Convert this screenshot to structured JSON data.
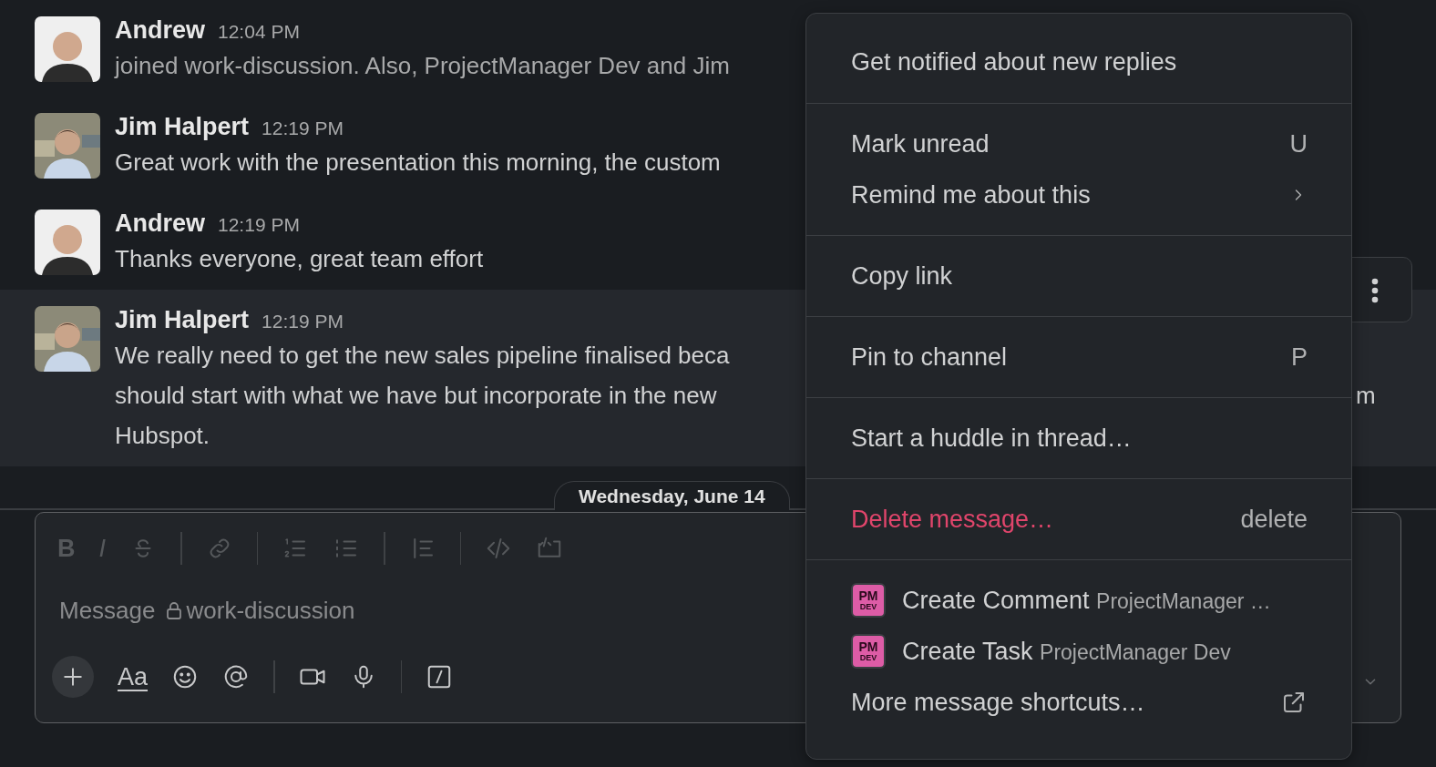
{
  "messages": [
    {
      "author": "Andrew",
      "time": "12:04 PM",
      "lines": [
        "joined work-discussion. Also, ProjectManager Dev and Jim"
      ],
      "muted": true,
      "highlighted": false
    },
    {
      "author": "Jim Halpert",
      "time": "12:19 PM",
      "lines": [
        "Great work with the presentation this morning, the custom"
      ],
      "muted": false,
      "highlighted": false
    },
    {
      "author": "Andrew",
      "time": "12:19 PM",
      "lines": [
        "Thanks everyone, great team effort"
      ],
      "muted": false,
      "highlighted": false
    },
    {
      "author": "Jim Halpert",
      "time": "12:19 PM",
      "lines": [
        "We really need to get the new sales pipeline finalised beca",
        "should start with what we have but incorporate in the new",
        "Hubspot."
      ],
      "muted": false,
      "highlighted": true,
      "trailing_fragment": "m"
    }
  ],
  "date_divider": "Wednesday, June 14",
  "composer": {
    "format_tools": [
      {
        "kind": "bold",
        "label": "B"
      },
      {
        "kind": "italic",
        "label": "I"
      },
      {
        "kind": "strike"
      },
      {
        "kind": "sep"
      },
      {
        "kind": "link"
      },
      {
        "kind": "sep"
      },
      {
        "kind": "ordered"
      },
      {
        "kind": "bullet"
      },
      {
        "kind": "sep"
      },
      {
        "kind": "quote"
      },
      {
        "kind": "sep"
      },
      {
        "kind": "code"
      },
      {
        "kind": "codeblock"
      }
    ],
    "placeholder": "Message",
    "channel": "work-discussion",
    "actions": [
      {
        "kind": "plus"
      },
      {
        "kind": "text",
        "label": "Aa"
      },
      {
        "kind": "emoji"
      },
      {
        "kind": "mention"
      },
      {
        "kind": "sep"
      },
      {
        "kind": "video"
      },
      {
        "kind": "mic"
      },
      {
        "kind": "sep"
      },
      {
        "kind": "slash"
      }
    ]
  },
  "menu": {
    "sections": [
      [
        {
          "kind": "plain",
          "label": "Get notified about new replies"
        }
      ],
      [
        {
          "kind": "plain",
          "label": "Mark unread",
          "shortcut": "U"
        },
        {
          "kind": "submenu",
          "label": "Remind me about this"
        }
      ],
      [
        {
          "kind": "plain",
          "label": "Copy link"
        }
      ],
      [
        {
          "kind": "plain",
          "label": "Pin to channel",
          "shortcut": "P"
        }
      ],
      [
        {
          "kind": "plain",
          "label": "Start a huddle in thread…"
        }
      ],
      [
        {
          "kind": "danger",
          "label": "Delete message…",
          "shortcut": "delete"
        }
      ],
      [
        {
          "kind": "app",
          "label": "Create Comment",
          "app": "ProjectManager …",
          "badge": "PM",
          "badge_sub": "DEV"
        },
        {
          "kind": "app",
          "label": "Create Task",
          "app": "ProjectManager Dev",
          "badge": "PM",
          "badge_sub": "DEV"
        },
        {
          "kind": "external",
          "label": "More message shortcuts…"
        }
      ]
    ]
  }
}
